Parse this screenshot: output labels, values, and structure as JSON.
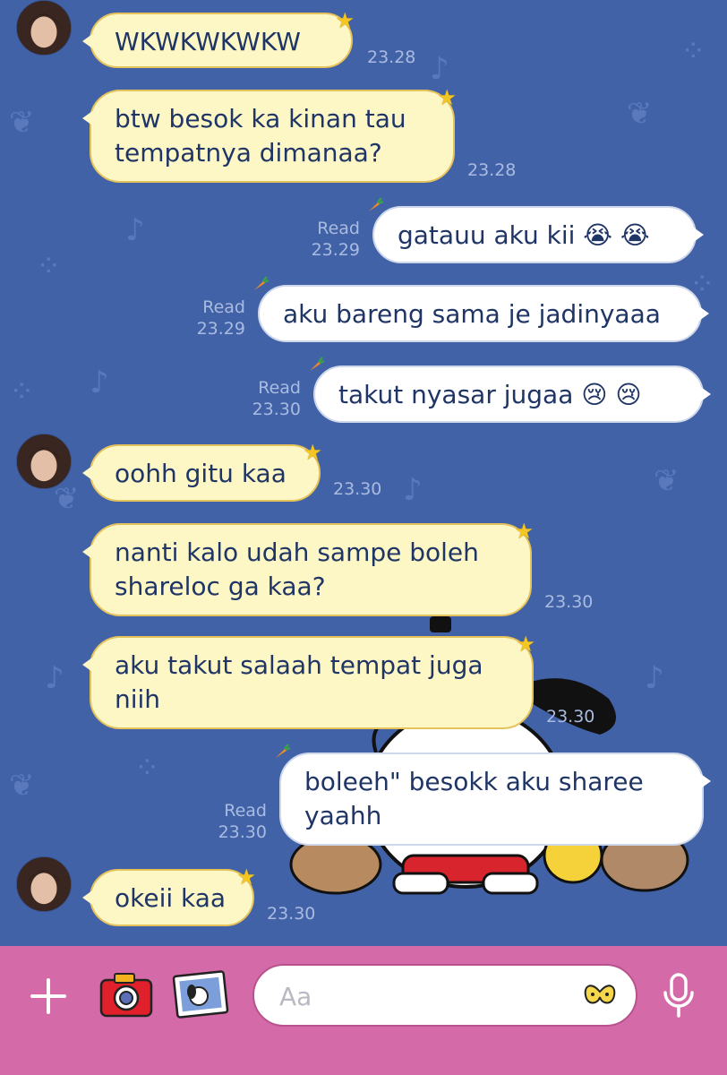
{
  "messages": [
    {
      "side": "in",
      "text_lines": [
        "WKWKWKWKW"
      ],
      "time": "23.28"
    },
    {
      "side": "in",
      "text_lines": [
        "btw besok ka kinan tau",
        "tempatnya dimanaa?"
      ],
      "time": "23.28"
    },
    {
      "side": "out",
      "text_lines": [
        "gatauu aku kii 😭 😭"
      ],
      "read": "Read",
      "time": "23.29"
    },
    {
      "side": "out",
      "text_lines": [
        "aku bareng sama je jadinyaaa"
      ],
      "read": "Read",
      "time": "23.29"
    },
    {
      "side": "out",
      "text_lines": [
        "takut nyasar jugaa 😢 😢"
      ],
      "read": "Read",
      "time": "23.30"
    },
    {
      "side": "in",
      "text_lines": [
        "oohh gitu kaa"
      ],
      "time": "23.30"
    },
    {
      "side": "in",
      "text_lines": [
        "nanti kalo udah sampe boleh",
        "shareloc ga kaa?"
      ],
      "time": "23.30"
    },
    {
      "side": "in",
      "text_lines": [
        "aku takut salaah tempat juga",
        "niih"
      ],
      "time": "23.30"
    },
    {
      "side": "out",
      "text_lines": [
        "boleeh\" besokk aku sharee",
        "yaahh"
      ],
      "read": "Read",
      "time": "23.30"
    },
    {
      "side": "in",
      "text_lines": [
        "okeii kaa"
      ],
      "time": "23.30"
    }
  ],
  "input": {
    "placeholder": "Aa"
  },
  "icons": {
    "add": "plus-icon",
    "camera": "camera-icon",
    "gallery": "photo-icon",
    "emoji": "emoji-icon",
    "mic": "microphone-icon"
  },
  "colors": {
    "chat_bg": "#4262a8",
    "incoming_bubble": "#fdf6c5",
    "outgoing_bubble": "#ffffff",
    "bar": "#d56aa9"
  }
}
